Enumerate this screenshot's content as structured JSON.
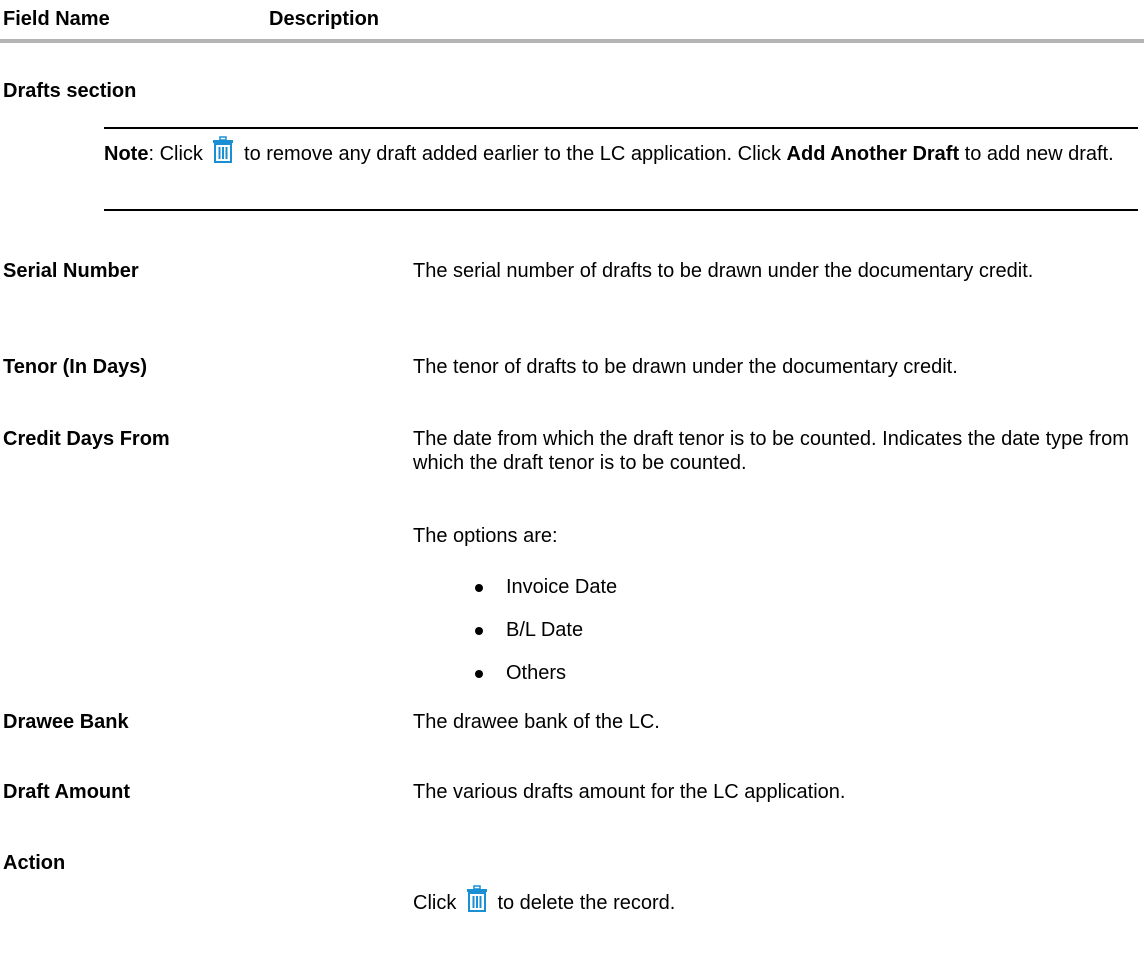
{
  "table_header": {
    "field_name": "Field Name",
    "description": "Description"
  },
  "section_title": "Drafts section",
  "note": {
    "label": "Note",
    "text_before_icon": ": Click ",
    "text_after_icon": " to remove any draft added earlier to the LC application. Click ",
    "bold_link": "Add Another Draft",
    "text_end": " to add new draft.",
    "icon": "trash-icon"
  },
  "fields": [
    {
      "name": "Serial Number",
      "description": "The serial number of drafts to be drawn under the documentary credit."
    },
    {
      "name": "Tenor (In Days)",
      "description": "The tenor of drafts to be drawn under the documentary credit."
    },
    {
      "name": "Credit Days From",
      "description": "The date from which the draft tenor is to be counted. Indicates the date type from which the draft tenor is to be counted."
    },
    {
      "name": "Drawee Bank",
      "description": "The drawee bank of the LC."
    },
    {
      "name": "Draft Amount",
      "description": "The various drafts amount for the LC application."
    },
    {
      "name": "Action",
      "description_before_icon": "Click ",
      "description_after_icon": " to delete the record."
    }
  ],
  "options_intro": "The options are:",
  "options": [
    "Invoice Date",
    "B/L Date",
    "Others"
  ],
  "colors": {
    "icon_blue": "#1a8fd4",
    "rule_gray": "#b5b5b5"
  }
}
